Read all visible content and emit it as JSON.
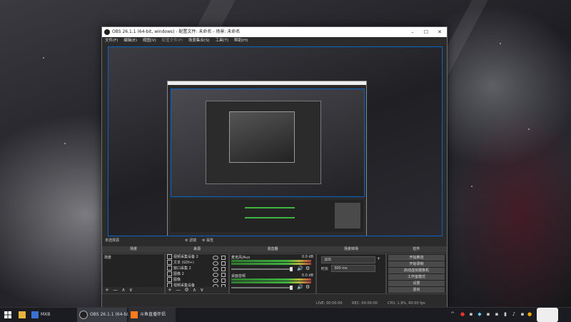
{
  "window": {
    "title": "OBS 26.1.1 (64-bit, windows) - 配置文件: 未命名 - 场景: 未命名",
    "minimize": "–",
    "maximize": "☐",
    "close": "✕"
  },
  "menu": [
    "文件(F)",
    "编辑(E)",
    "视图(V)",
    "配置文件(P)",
    "场景集合(S)",
    "工具(T)",
    "帮助(H)"
  ],
  "preview_bar": {
    "label": "未选择源",
    "filter_btn": "滤镜",
    "props_btn": "属性"
  },
  "docks": {
    "scenes": {
      "title": "场景",
      "items": [
        "场景"
      ]
    },
    "sources": {
      "title": "来源",
      "items": [
        "视频采集设备 2",
        "文本 (GDI+)",
        "窗口采集 2",
        "图像 2",
        "图像",
        "视频采集设备"
      ]
    },
    "mixer": {
      "title": "混音器",
      "channels": [
        {
          "name": "麦克风/Aux",
          "db": "0.0 dB"
        },
        {
          "name": "桌面音频",
          "db": "0.0 dB"
        }
      ]
    },
    "transitions": {
      "title": "场景转场",
      "selected": "淡出",
      "duration_label": "时长",
      "duration_value": "300 ms"
    },
    "controls": {
      "title": "控件",
      "buttons": [
        "开始推流",
        "开始录制",
        "启动虚拟摄像机",
        "工作室模式",
        "设置",
        "退出"
      ]
    }
  },
  "toolbar_glyphs": {
    "add": "+",
    "remove": "—",
    "up": "∧",
    "down": "∨",
    "gear": "⚙"
  },
  "status": {
    "live": "LIVE: 00:00:00",
    "rec": "REC: 00:00:00",
    "cpu": "CPU: 1.9%, 60.00 fps"
  },
  "taskbar": {
    "items": [
      {
        "label": "MXB",
        "icon": "mxb-icon"
      },
      {
        "label": "OBS 26.1.1 (64-bi...",
        "icon": "obs-icon"
      },
      {
        "label": "斗鱼直播伴侣",
        "icon": "douyu-icon"
      }
    ]
  }
}
